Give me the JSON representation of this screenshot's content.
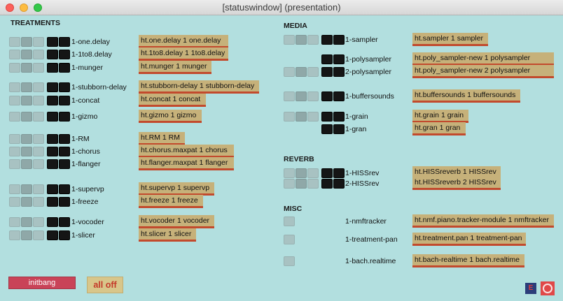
{
  "window": {
    "title": "[statuswindow] (presentation)"
  },
  "sections": {
    "treatments": "TREATMENTS",
    "media": "MEDIA",
    "reverb": "REVERB",
    "misc": "MISC"
  },
  "treatments": [
    {
      "label": "1-one.delay",
      "message": "ht.one.delay 1 one.delay"
    },
    {
      "label": "1-1to8.delay",
      "message": "ht.1to8.delay 1 1to8.delay"
    },
    {
      "label": "1-munger",
      "message": "ht.munger 1 munger"
    },
    {
      "label": "1-stubborn-delay",
      "message": "ht.stubborn-delay 1 stubborn-delay"
    },
    {
      "label": "1-concat",
      "message": "ht.concat 1 concat"
    },
    {
      "label": "1-gizmo",
      "message": "ht.gizmo 1 gizmo"
    },
    {
      "label": "1-RM",
      "message": "ht.RM 1 RM"
    },
    {
      "label": "1-chorus",
      "message": "ht.chorus.maxpat 1 chorus"
    },
    {
      "label": "1-flanger",
      "message": "ht.flanger.maxpat 1 flanger"
    },
    {
      "label": "1-supervp",
      "message": "ht.supervp 1 supervp"
    },
    {
      "label": "1-freeze",
      "message": "ht.freeze 1 freeze"
    },
    {
      "label": "1-vocoder",
      "message": "ht.vocoder 1 vocoder"
    },
    {
      "label": "1-slicer",
      "message": "ht.slicer 1 slicer"
    }
  ],
  "media": [
    {
      "label": "1-sampler",
      "message": "ht.sampler 1 sampler"
    },
    {
      "label": "1-polysampler",
      "message": "ht.poly_sampler-new 1 polysampler"
    },
    {
      "label": "2-polysampler",
      "message": "ht.poly_sampler-new 2 polysampler"
    },
    {
      "label": "1-buffersounds",
      "message": "ht.buffersounds 1 buffersounds"
    },
    {
      "label": "1-grain",
      "message": "ht.grain 1 grain"
    },
    {
      "label": "1-gran",
      "message": "ht.gran 1 gran"
    }
  ],
  "reverb": [
    {
      "label": "1-HISSrev",
      "message": "ht.HISSreverb 1 HISSrev"
    },
    {
      "label": "2-HISSrev",
      "message": "ht.HISSreverb 2 HISSrev"
    }
  ],
  "misc": [
    {
      "label": "1-nmftracker",
      "message": "ht.nmf.piano.tracker-module 1 nmftracker"
    },
    {
      "label": "1-treatment-pan",
      "message": "ht.treatment.pan 1 treatment-pan"
    },
    {
      "label": "1-bach.realtime",
      "message": "ht.bach-realtime 1 bach.realtime"
    }
  ],
  "buttons": {
    "initbang": "initbang",
    "all_off": "all off"
  },
  "corner_icons": {
    "editor": "E",
    "record": "record-icon"
  },
  "colors": {
    "background": "#b2dfdf",
    "message_box": "#c6b17a",
    "message_underline": "#c24a2d",
    "initbang": "#c94358",
    "all_off": "#d8c68a"
  }
}
